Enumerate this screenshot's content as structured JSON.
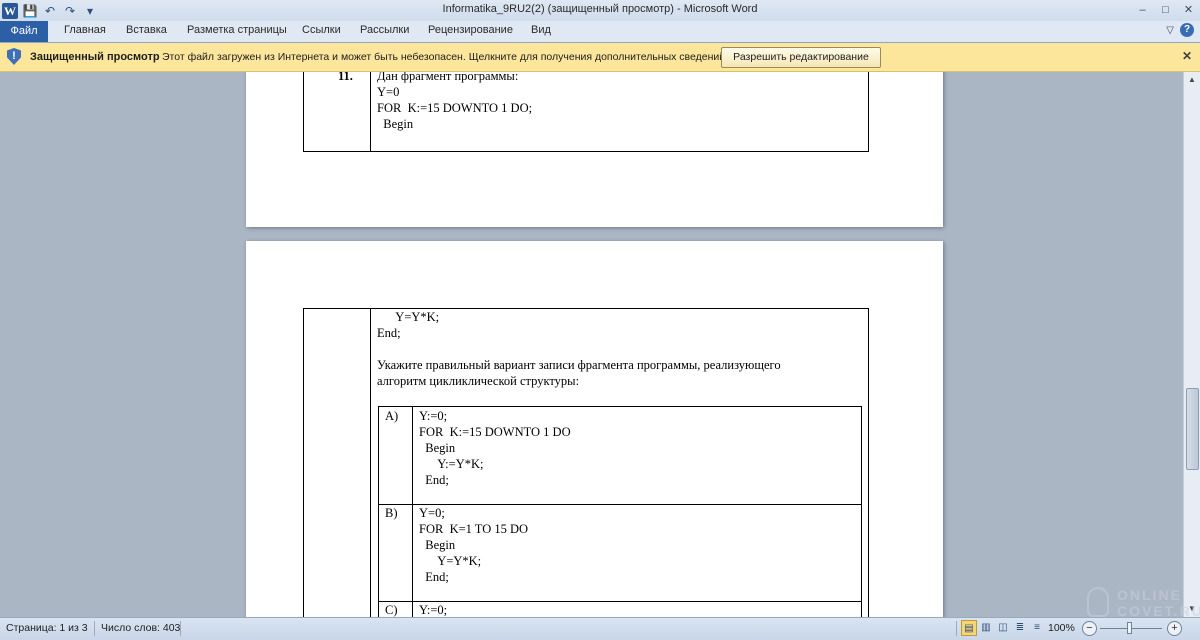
{
  "window": {
    "title": "Informatika_9RU2(2) (защищенный просмотр)  -  Microsoft Word",
    "controls": {
      "minimize": "–",
      "maximize": "□",
      "close": "✕"
    }
  },
  "qat": {
    "word_icon": "W",
    "save": "💾",
    "undo": "↶",
    "redo": "↷",
    "customize": "▾"
  },
  "ribbon": {
    "tabs": [
      "Файл",
      "Главная",
      "Вставка",
      "Разметка страницы",
      "Ссылки",
      "Рассылки",
      "Рецензирование",
      "Вид"
    ],
    "help_chevron": "▽",
    "help_icon": "?"
  },
  "message_bar": {
    "title": "Защищенный просмотр",
    "text": "Этот файл загружен из Интернета и может быть небезопасен. Щелкните для получения дополнительных сведений.",
    "button": "Разрешить редактирование",
    "close": "✕",
    "icon": "shield-icon"
  },
  "document": {
    "page1": {
      "question_number": "11.",
      "lines": [
        "Дан фрагмент программы:",
        "Y=0",
        "FOR  K:=15 DOWNTO 1 DO;",
        "  Begin"
      ]
    },
    "page2": {
      "lines": [
        "      Y=Y*K;",
        "End;"
      ],
      "prompt": [
        "Укажите правильный вариант записи фрагмента программы, реализующего",
        "алгоритм цикликлической структуры:"
      ],
      "options": [
        {
          "label": "A)",
          "lines": [
            "Y:=0;",
            "FOR  K:=15 DOWNTO 1 DO",
            "  Begin",
            "      Y:=Y*K;",
            "  End;"
          ]
        },
        {
          "label": "B)",
          "lines": [
            "Y=0;",
            "FOR  K=1 TO 15 DO",
            "  Begin",
            "      Y=Y*K;",
            "  End;"
          ]
        },
        {
          "label": "C)",
          "lines": [
            "Y:=0;"
          ]
        }
      ]
    }
  },
  "statusbar": {
    "page": "Страница: 1 из 3",
    "words": "Число слов: 403",
    "zoom": "100%",
    "zoom_minus": "−",
    "zoom_plus": "+"
  },
  "watermark": {
    "line1": "ONLINE",
    "line2": "COVET.RU"
  }
}
